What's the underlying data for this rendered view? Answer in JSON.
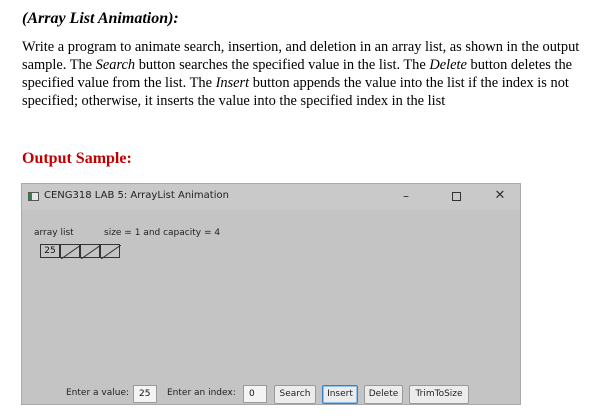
{
  "doc": {
    "heading": "(Array List Animation):",
    "para": {
      "p1": "Write a program to animate search, insertion, and deletion in an array list, as shown in the output sample. The ",
      "search_word": "Search",
      "p2": " button searches the specified value in the list. The ",
      "delete_word": "Delete",
      "p3": " button deletes the specified value from the list. The ",
      "insert_word": "Insert",
      "p4": " button appends the value into the list if the index is not specified; otherwise, it inserts the value into the specified index in the list"
    },
    "output_heading": "Output Sample:"
  },
  "window": {
    "title": "CENG318 LAB 5: ArrayList Animation",
    "controls": {
      "minimize": "–",
      "close": "✕"
    },
    "status_label": "array list",
    "size_label": "size = 1 and capacity = 4",
    "cells": [
      "25",
      "",
      "",
      ""
    ],
    "value_label": "Enter a value:",
    "value": "25",
    "index_label": "Enter an index:",
    "index": "0",
    "buttons": {
      "search": "Search",
      "insert": "Insert",
      "delete": "Delete",
      "trim": "TrimToSize"
    }
  }
}
